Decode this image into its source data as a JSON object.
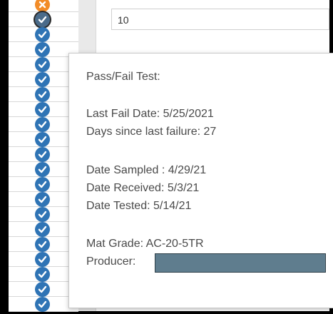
{
  "input": {
    "value": "10"
  },
  "rows": [
    {
      "status": "fail"
    },
    {
      "status": "pass",
      "selected": true
    },
    {
      "status": "pass"
    },
    {
      "status": "pass"
    },
    {
      "status": "pass"
    },
    {
      "status": "pass"
    },
    {
      "status": "pass"
    },
    {
      "status": "pass"
    },
    {
      "status": "pass"
    },
    {
      "status": "pass"
    },
    {
      "status": "pass"
    },
    {
      "status": "pass"
    },
    {
      "status": "pass"
    },
    {
      "status": "pass"
    },
    {
      "status": "pass"
    },
    {
      "status": "pass"
    },
    {
      "status": "pass"
    },
    {
      "status": "pass"
    },
    {
      "status": "pass"
    },
    {
      "status": "pass"
    },
    {
      "status": "pass"
    }
  ],
  "tooltip": {
    "title": "Pass/Fail Test:",
    "last_fail_date": "Last Fail Date: 5/25/2021",
    "days_since_failure": "Days since last failure: 27",
    "date_sampled": "Date Sampled : 4/29/21",
    "date_received": "Date Received: 5/3/21",
    "date_tested": "Date Tested: 5/14/21",
    "mat_grade": "Mat Grade: AC-20-5TR",
    "producer_label": "Producer:"
  },
  "colors": {
    "pass": "#2f74b5",
    "fail": "#f28c28",
    "redaction": "#5f7d8e"
  }
}
